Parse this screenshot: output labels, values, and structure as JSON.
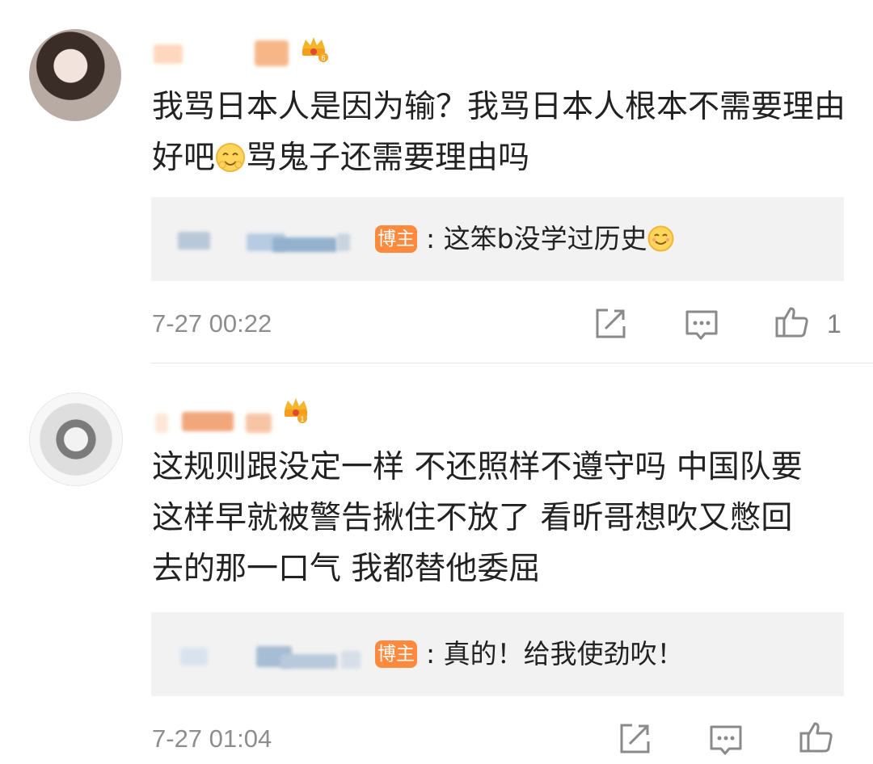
{
  "comments": [
    {
      "text_a": "我骂日本人是因为输？我骂日本人根本不需要理由好吧",
      "emoji_a": "hug-face-emoji",
      "text_b": "骂鬼子还需要理由吗",
      "crown_level": "6",
      "reply": {
        "badge": "博主",
        "separator": ":",
        "text": "这笨b没学过历史",
        "emoji": "smile-face-emoji"
      },
      "time": "7-27 00:22",
      "like_count": "1"
    },
    {
      "text": "这规则跟没定一样 不还照样不遵守吗 中国队要这样早就被警告揪住不放了 看昕哥想吹又憋回去的那一口气 我都替他委屈",
      "crown_level": "1",
      "reply": {
        "badge": "博主",
        "separator": ":",
        "text": "真的！给我使劲吹！"
      },
      "time": "7-27 01:04",
      "like_count": ""
    }
  ],
  "icons": {
    "share": "share-icon",
    "comment": "comment-icon",
    "like": "thumbs-up-icon",
    "crown": "vip-crown-icon"
  },
  "colors": {
    "badge": "#ff8a3d",
    "reply_bg": "#f2f2f2",
    "meta_text": "#8d8d8d"
  }
}
